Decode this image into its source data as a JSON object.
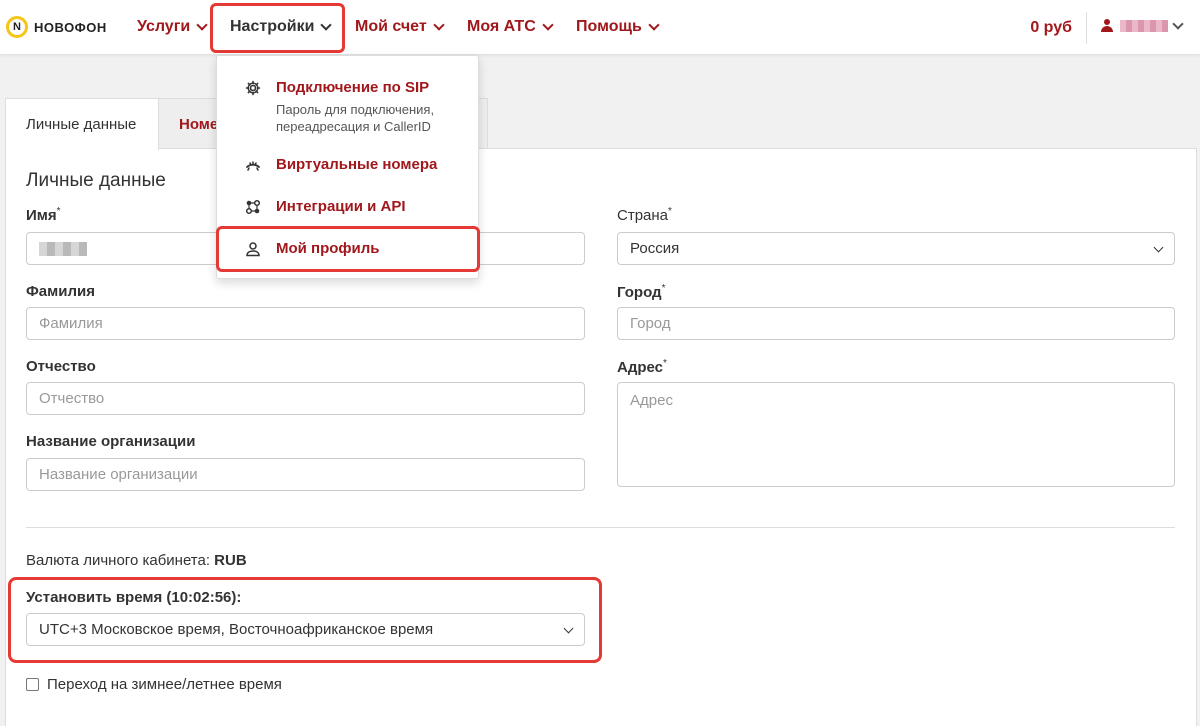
{
  "header": {
    "logo_text": "НОВОФОН",
    "logo_mark": "N",
    "nav": [
      {
        "label": "Услуги"
      },
      {
        "label": "Настройки"
      },
      {
        "label": "Мой счет"
      },
      {
        "label": "Моя АТС"
      },
      {
        "label": "Помощь"
      }
    ],
    "balance": "0 руб"
  },
  "dropdown": {
    "items": [
      {
        "title": "Подключение по SIP",
        "subtitle_line1": "Пароль для подключения,",
        "subtitle_line2": "переадресация и CallerID",
        "icon": "gear-icon"
      },
      {
        "title": "Виртуальные номера",
        "icon": "phone-signal-icon"
      },
      {
        "title": "Интеграции и API",
        "icon": "nodes-icon"
      },
      {
        "title": "Мой профиль",
        "icon": "person-icon"
      }
    ]
  },
  "tabs": [
    {
      "label": "Личные данные",
      "active": true
    },
    {
      "label": "Номе",
      "active": false
    }
  ],
  "form": {
    "title": "Личные данные",
    "required_mark": "*",
    "first_name": {
      "label": "Имя"
    },
    "last_name": {
      "label": "Фамилия",
      "placeholder": "Фамилия"
    },
    "middle_name": {
      "label": "Отчество",
      "placeholder": "Отчество"
    },
    "organization": {
      "label": "Название организации",
      "placeholder": "Название организации"
    },
    "country": {
      "label": "Страна",
      "value": "Россия"
    },
    "city": {
      "label": "Город",
      "placeholder": "Город"
    },
    "address": {
      "label": "Адрес",
      "placeholder": "Адрес"
    },
    "currency_label": "Валюта личного кабинета:",
    "currency_value": "RUB",
    "time_label": "Установить время (10:02:56):",
    "timezone_value": "UTC+3 Московское время, Восточноафриканское время",
    "dst_label": "Переход на зимнее/летнее время"
  },
  "colors": {
    "brand": "#a0181c",
    "highlight": "#e53935",
    "logo_yellow": "#f5c518"
  }
}
